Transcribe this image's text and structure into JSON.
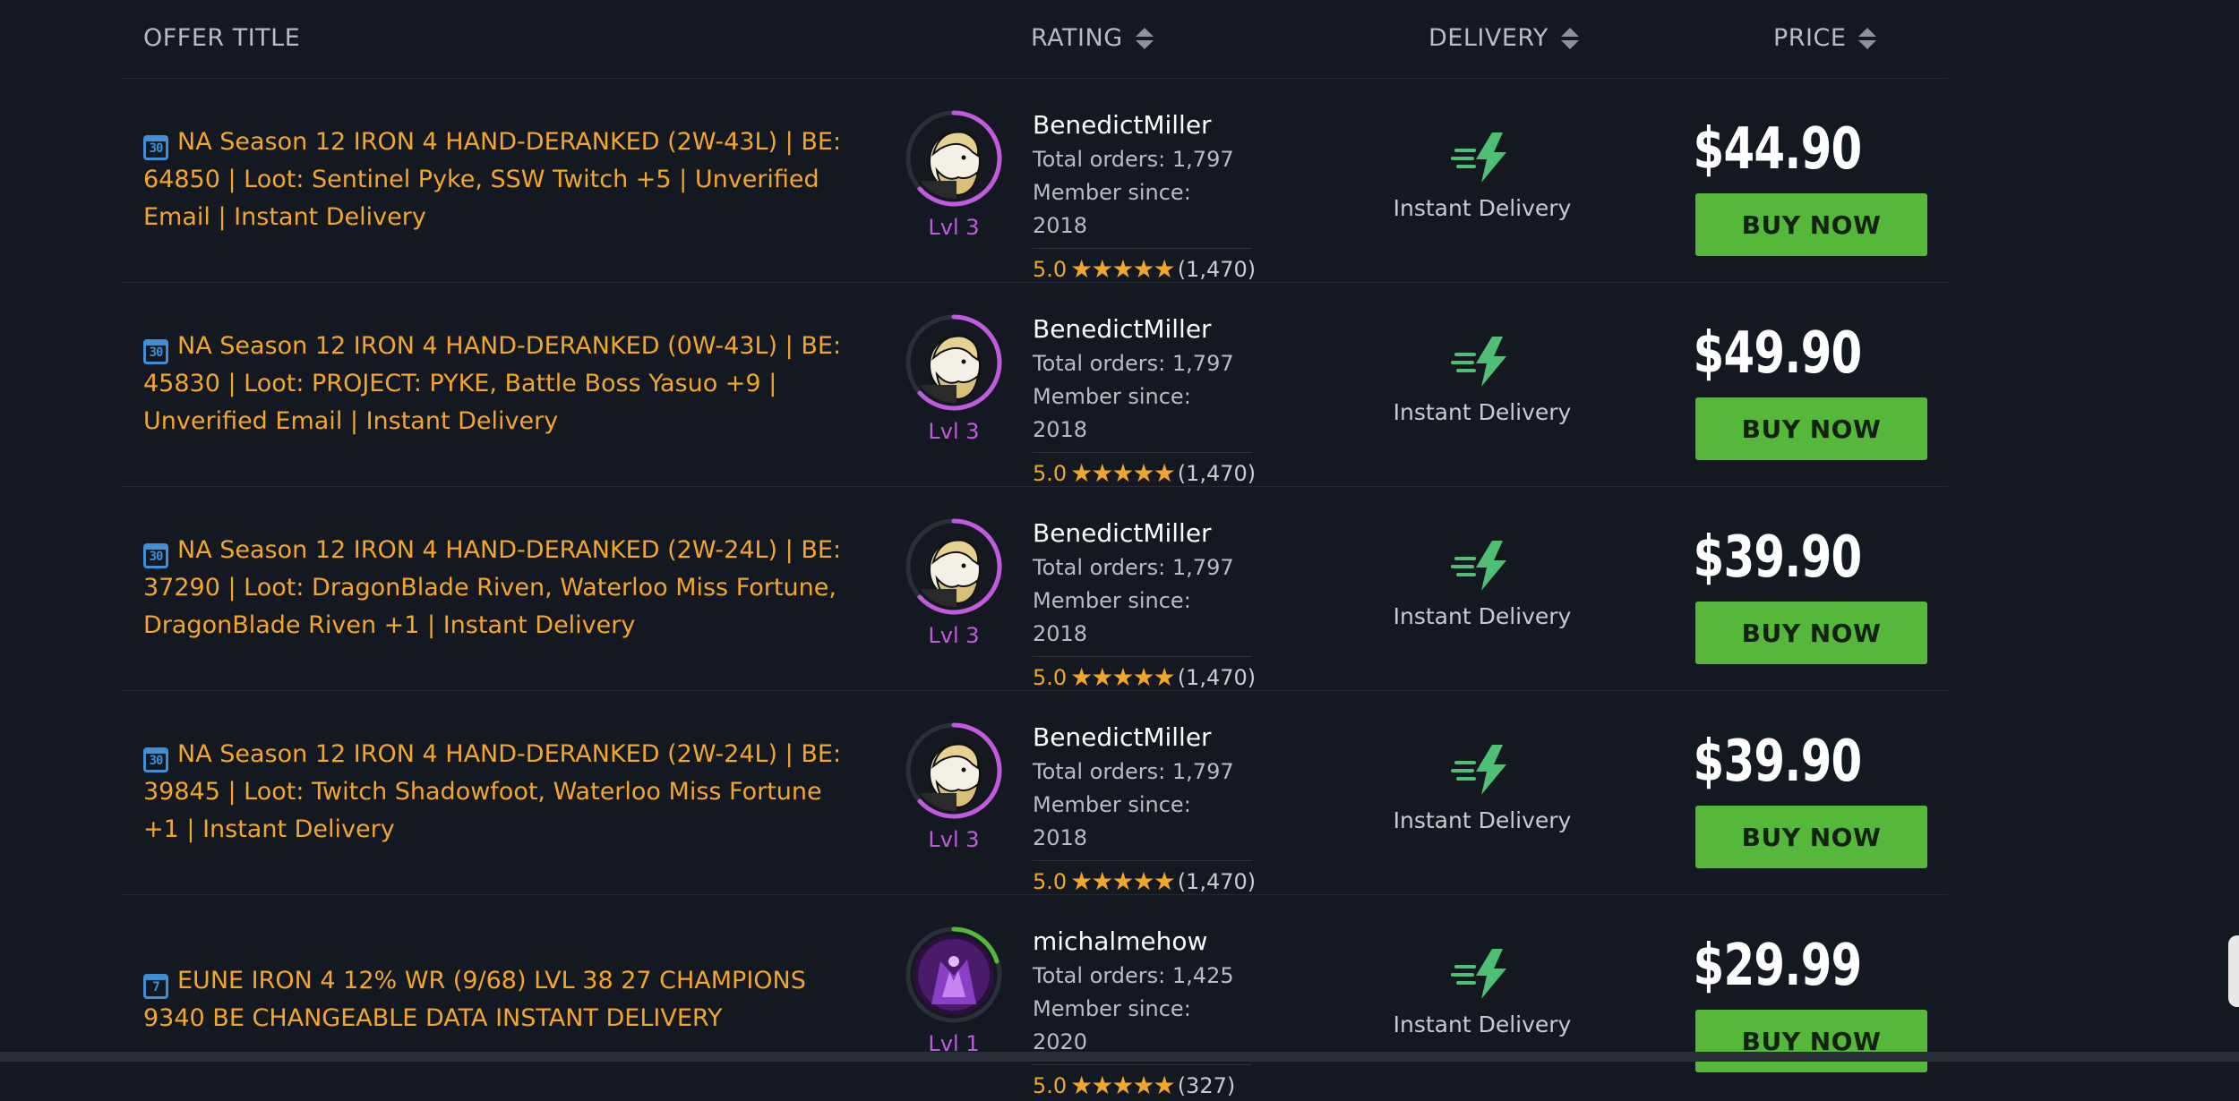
{
  "header": {
    "offer_title": "OFFER TITLE",
    "rating": "RATING",
    "delivery": "DELIVERY",
    "price": "PRICE"
  },
  "offers": [
    {
      "days": "30",
      "title": "NA Season 12 IRON 4 HAND-DERANKED (2W-43L) | BE: 64850 | Loot: Sentinel Pyke, SSW Twitch +5 | Unverified Email | Instant Delivery",
      "seller": "BenedictMiller",
      "orders": "Total orders: 1,797",
      "member": "Member since: 2018",
      "score": "5.0",
      "reviews": "(1,470)",
      "level": "Lvl 3",
      "delivery": "Instant Delivery",
      "price": "$44.90",
      "buy": "BUY NOW"
    },
    {
      "days": "30",
      "title": "NA Season 12 IRON 4 HAND-DERANKED (0W-43L) | BE: 45830 | Loot: PROJECT: PYKE, Battle Boss Yasuo +9 | Unverified Email | Instant Delivery",
      "seller": "BenedictMiller",
      "orders": "Total orders: 1,797",
      "member": "Member since: 2018",
      "score": "5.0",
      "reviews": "(1,470)",
      "level": "Lvl 3",
      "delivery": "Instant Delivery",
      "price": "$49.90",
      "buy": "BUY NOW"
    },
    {
      "days": "30",
      "title": "NA Season 12 IRON 4 HAND-DERANKED (2W-24L) | BE: 37290 | Loot: DragonBlade Riven, Waterloo Miss Fortune, DragonBlade Riven +1 | Instant Delivery",
      "seller": "BenedictMiller",
      "orders": "Total orders: 1,797",
      "member": "Member since: 2018",
      "score": "5.0",
      "reviews": "(1,470)",
      "level": "Lvl 3",
      "delivery": "Instant Delivery",
      "price": "$39.90",
      "buy": "BUY NOW"
    },
    {
      "days": "30",
      "title": "NA Season 12 IRON 4 HAND-DERANKED (2W-24L) | BE: 39845 | Loot: Twitch Shadowfoot, Waterloo Miss Fortune +1 | Instant Delivery",
      "seller": "BenedictMiller",
      "orders": "Total orders: 1,797",
      "member": "Member since: 2018",
      "score": "5.0",
      "reviews": "(1,470)",
      "level": "Lvl 3",
      "delivery": "Instant Delivery",
      "price": "$39.90",
      "buy": "BUY NOW"
    },
    {
      "days": "7",
      "title": "EUNE IRON 4 12% WR (9/68) LVL 38 27 CHAMPIONS 9340 BE CHANGEABLE DATA INSTANT DELIVERY",
      "seller": "michalmehow",
      "orders": "Total orders: 1,425",
      "member": "Member since: 2020",
      "score": "5.0",
      "reviews": "(327)",
      "level": "Lvl 1",
      "delivery": "Instant Delivery",
      "price": "$29.99",
      "buy": "BUY NOW"
    }
  ],
  "colors": {
    "background": "#141821",
    "offer_title": "#f3a62c",
    "buy_button": "#55b83b",
    "level_ring_purple": "#c25ae0",
    "level_ring_green": "#55b83b",
    "delivery_icon": "#4fbf73"
  },
  "icons": {
    "calendar": "calendar-icon",
    "sort": "sort-icon",
    "delivery": "lightning-bolt-icon",
    "star": "star-icon"
  }
}
